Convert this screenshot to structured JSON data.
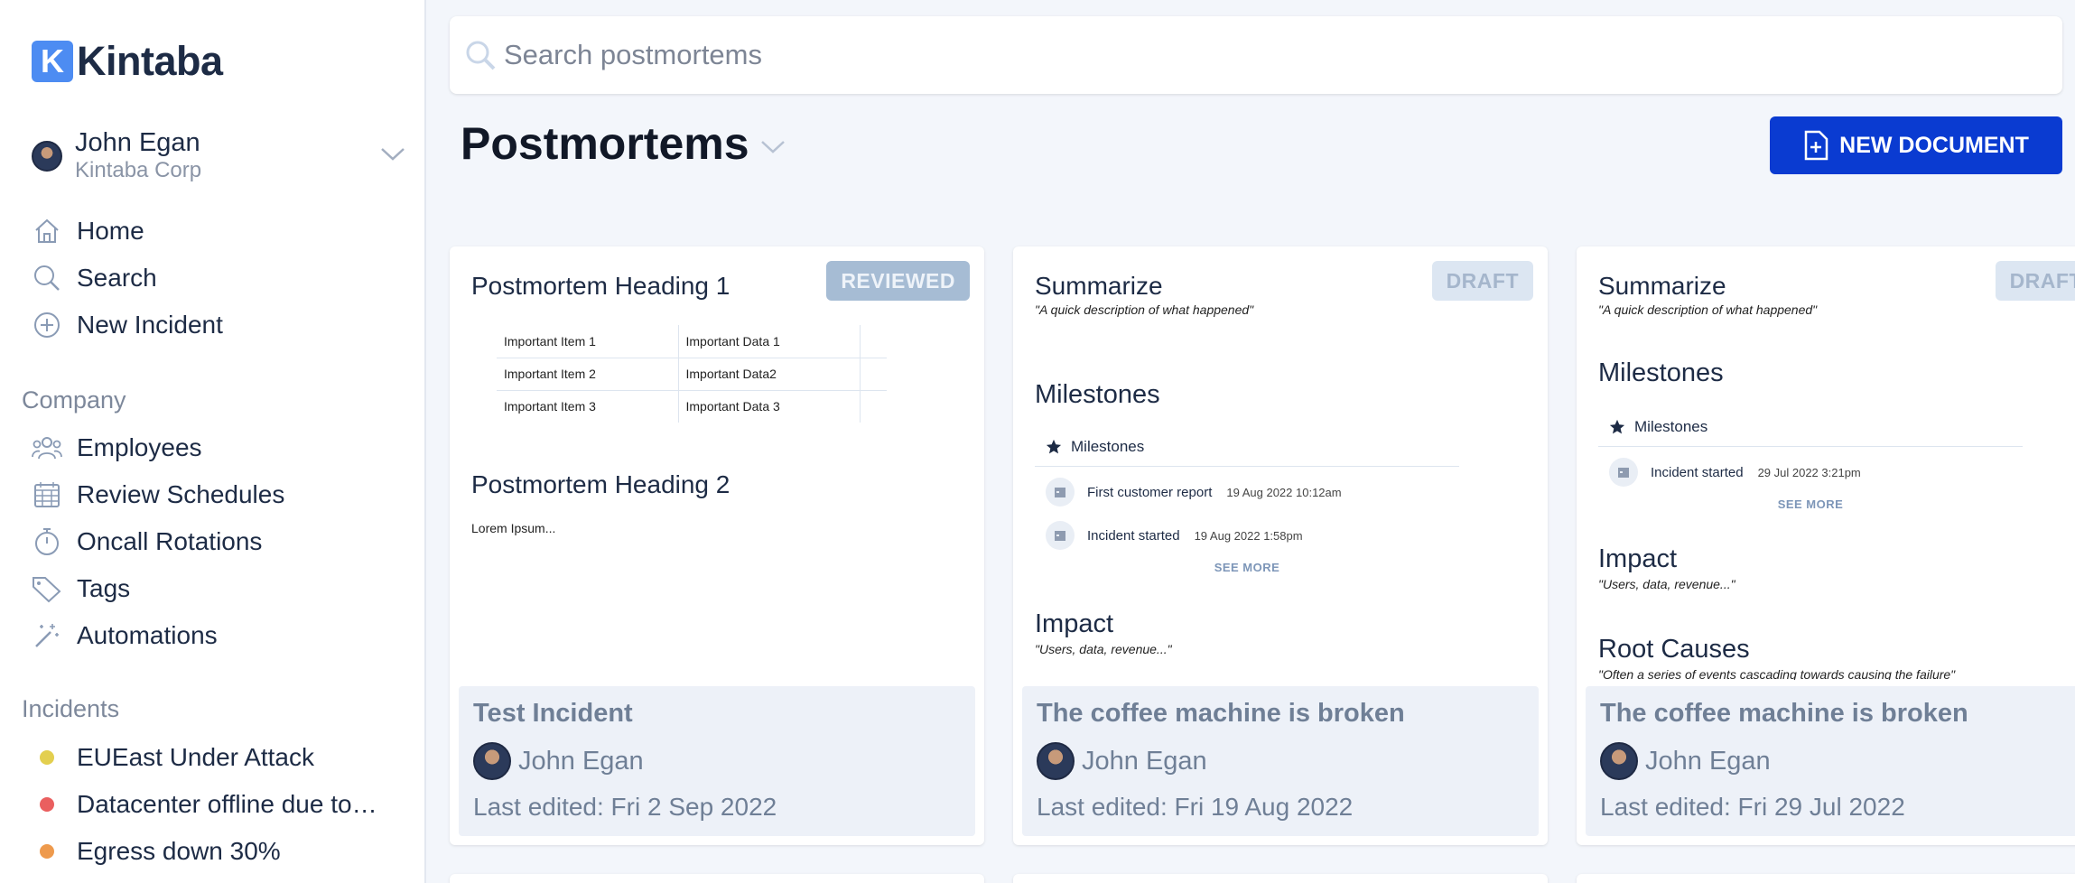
{
  "app": {
    "logo_letter": "K",
    "name": "Kintaba"
  },
  "user": {
    "name": "John Egan",
    "org": "Kintaba Corp"
  },
  "nav": [
    {
      "label": "Home",
      "icon": "home-icon"
    },
    {
      "label": "Search",
      "icon": "search-icon"
    },
    {
      "label": "New Incident",
      "icon": "plus-circle-icon"
    }
  ],
  "company": {
    "title": "Company",
    "items": [
      {
        "label": "Employees",
        "icon": "people-icon"
      },
      {
        "label": "Review Schedules",
        "icon": "calendar-icon"
      },
      {
        "label": "Oncall Rotations",
        "icon": "stopwatch-icon"
      },
      {
        "label": "Tags",
        "icon": "tag-icon"
      },
      {
        "label": "Automations",
        "icon": "magic-wand-icon"
      }
    ]
  },
  "incidents": {
    "title": "Incidents",
    "items": [
      {
        "label": "EUEast Under Attack",
        "color": "#e3cf4f"
      },
      {
        "label": "Datacenter offline due to…",
        "color": "#ea5f5f"
      },
      {
        "label": "Egress down 30%",
        "color": "#ee9a4d"
      }
    ]
  },
  "search": {
    "placeholder": "Search postmortems"
  },
  "page": {
    "title": "Postmortems",
    "new_document": "NEW DOCUMENT"
  },
  "cards": [
    {
      "badge": "REVIEWED",
      "heading1": "Postmortem Heading 1",
      "table": [
        [
          "Important Item 1",
          "Important Data 1"
        ],
        [
          "Important Item 2",
          "Important Data2"
        ],
        [
          "Important Item 3",
          "Important Data 3"
        ]
      ],
      "heading2": "Postmortem Heading 2",
      "body": "Lorem Ipsum...",
      "title": "Test Incident",
      "author": "John Egan",
      "edited": "Last edited: Fri 2 Sep 2022"
    },
    {
      "badge": "DRAFT",
      "summary": "Summarize",
      "summary_quote": "\"A quick description of what happened\"",
      "milestones_heading": "Milestones",
      "milestones_label": "Milestones",
      "milestones": [
        {
          "label": "First customer report",
          "date": "19 Aug 2022 10:12am"
        },
        {
          "label": "Incident started",
          "date": "19 Aug 2022 1:58pm"
        }
      ],
      "see_more": "SEE MORE",
      "impact": "Impact",
      "impact_quote": "\"Users, data, revenue...\"",
      "title": "The coffee machine is broken",
      "author": "John Egan",
      "edited": "Last edited: Fri 19 Aug 2022"
    },
    {
      "badge": "DRAFT",
      "summary": "Summarize",
      "summary_quote": "\"A quick description of what happened\"",
      "milestones_heading": "Milestones",
      "milestones_label": "Milestones",
      "milestones": [
        {
          "label": "Incident started",
          "date": "29 Jul 2022 3:21pm"
        }
      ],
      "see_more": "SEE MORE",
      "impact": "Impact",
      "impact_quote": "\"Users, data, revenue...\"",
      "root_causes": "Root Causes",
      "root_causes_quote": "\"Often a series of events cascading towards causing the failure\"",
      "title": "The coffee machine is broken",
      "author": "John Egan",
      "edited": "Last edited: Fri 29 Jul 2022"
    }
  ],
  "colors": {
    "primary": "#0a3bd1",
    "logo": "#4d8cf2",
    "text_dark": "#1d2b45",
    "muted": "#6f7f96",
    "page_bg": "#f3f6fb"
  }
}
